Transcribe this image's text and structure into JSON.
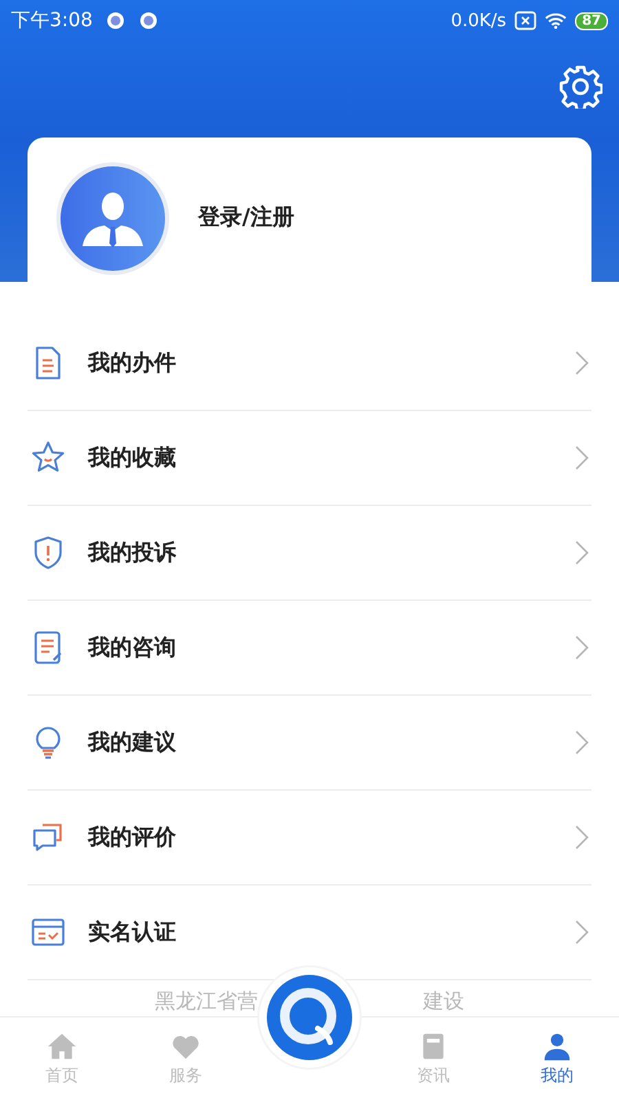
{
  "status_bar": {
    "time": "下午3:08",
    "speed": "0.0K/s",
    "battery": "87"
  },
  "profile": {
    "login_label": "登录/注册"
  },
  "menu": [
    {
      "label": "我的办件",
      "kind": "document"
    },
    {
      "label": "我的收藏",
      "kind": "star"
    },
    {
      "label": "我的投诉",
      "kind": "shield"
    },
    {
      "label": "我的咨询",
      "kind": "note"
    },
    {
      "label": "我的建议",
      "kind": "bulb"
    },
    {
      "label": "我的评价",
      "kind": "chat"
    },
    {
      "label": "实名认证",
      "kind": "card"
    }
  ],
  "footer_text": [
    "黑龙江省营",
    "建设"
  ],
  "bottom_nav": [
    {
      "label": "首页",
      "kind": "home",
      "selected": false
    },
    {
      "label": "服务",
      "kind": "heart",
      "selected": false
    },
    {
      "kind": "center",
      "selected": false
    },
    {
      "label": "资讯",
      "kind": "news",
      "selected": false
    },
    {
      "label": "我的",
      "kind": "person",
      "selected": true
    }
  ]
}
